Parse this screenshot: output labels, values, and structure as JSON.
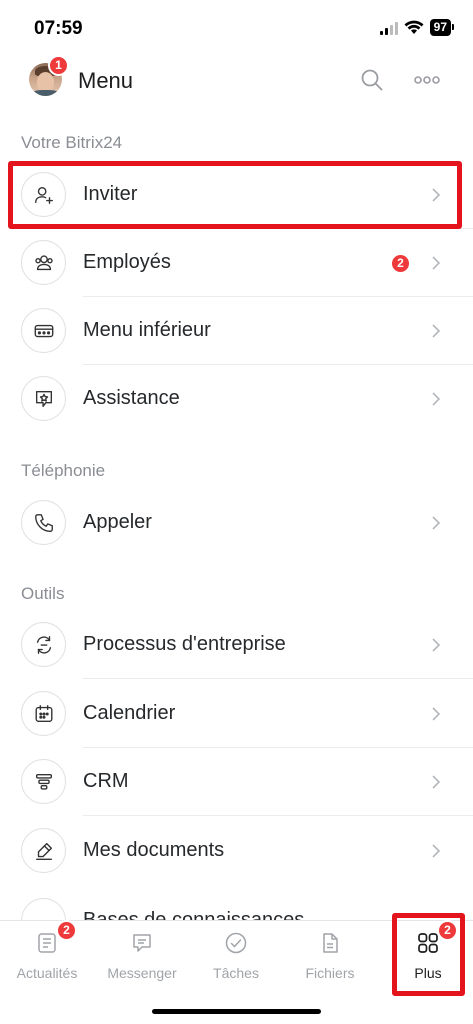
{
  "status_bar": {
    "time": "07:59",
    "battery": "97"
  },
  "header": {
    "title": "Menu",
    "avatar_badge": "1",
    "search_icon": "search-icon",
    "more_icon": "more-icon"
  },
  "sections": [
    {
      "label": "Votre Bitrix24"
    },
    {
      "label": "Téléphonie"
    },
    {
      "label": "Outils"
    }
  ],
  "items": [
    {
      "label": "Inviter",
      "icon": "user-plus-icon"
    },
    {
      "label": "Employés",
      "icon": "users-icon",
      "badge": "2"
    },
    {
      "label": "Menu inférieur",
      "icon": "menu-bar-icon"
    },
    {
      "label": "Assistance",
      "icon": "support-star-icon"
    },
    {
      "label": "Appeler",
      "icon": "phone-icon"
    },
    {
      "label": "Processus d'entreprise",
      "icon": "workflow-icon"
    },
    {
      "label": "Calendrier",
      "icon": "calendar-icon"
    },
    {
      "label": "CRM",
      "icon": "crm-funnel-icon"
    },
    {
      "label": "Mes documents",
      "icon": "pen-icon"
    },
    {
      "label": "Bases de connaissances",
      "icon": "knowledge-icon"
    }
  ],
  "tabs": [
    {
      "label": "Actualités",
      "icon": "news-icon",
      "badge": "2"
    },
    {
      "label": "Messenger",
      "icon": "chat-icon"
    },
    {
      "label": "Tâches",
      "icon": "check-circle-icon"
    },
    {
      "label": "Fichiers",
      "icon": "file-icon"
    },
    {
      "label": "Plus",
      "icon": "grid-icon",
      "badge": "2",
      "active": true
    }
  ],
  "colors": {
    "accent_red": "#ee3a3a",
    "highlight_red": "#e3141c",
    "muted_text": "#8a8d93"
  }
}
